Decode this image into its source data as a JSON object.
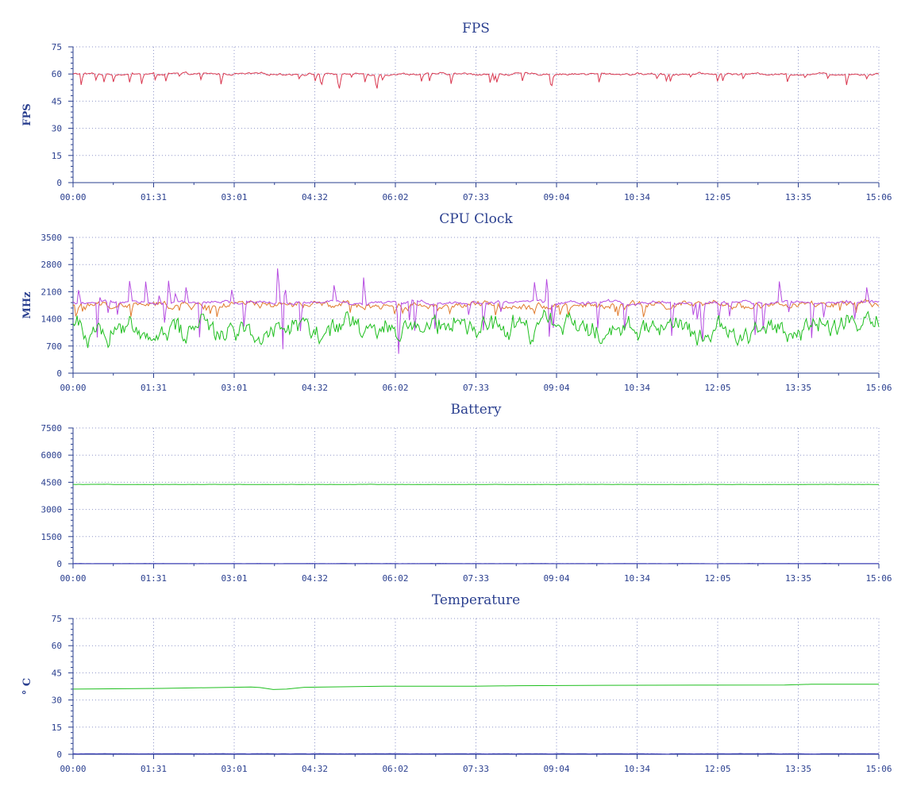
{
  "chart_data": [
    {
      "type": "line",
      "title": "FPS",
      "ylabel": "FPS",
      "ylim": [
        0,
        75
      ],
      "yticks": [
        "0",
        "15",
        "30",
        "45",
        "60",
        "75"
      ],
      "xticks": [
        "00:00",
        "01:31",
        "03:01",
        "04:32",
        "06:02",
        "07:33",
        "09:04",
        "10:34",
        "12:05",
        "13:35",
        "15:06"
      ],
      "xlim_seconds": [
        0,
        906
      ],
      "grid": true,
      "series": [
        {
          "color": "#d9374f",
          "base": 60,
          "noise": 0.8,
          "dips": 45,
          "dip_depth": 6,
          "lo": 52,
          "hi": 62
        }
      ]
    },
    {
      "type": "line",
      "title": "CPU Clock",
      "ylabel": "MHz",
      "ylim": [
        0,
        3500
      ],
      "yticks": [
        "0",
        "700",
        "1400",
        "2100",
        "2800",
        "3500"
      ],
      "xticks": [
        "00:00",
        "01:31",
        "03:01",
        "04:32",
        "06:02",
        "07:33",
        "09:04",
        "10:34",
        "12:05",
        "13:35",
        "15:06"
      ],
      "xlim_seconds": [
        0,
        906
      ],
      "grid": true,
      "series": [
        {
          "color": "#e07a2c",
          "base": 1750,
          "noise": 120,
          "dips": 25,
          "dip_depth": 300,
          "lo": 1450,
          "hi": 2250
        },
        {
          "color": "#b54be0",
          "base": 1820,
          "noise": 60,
          "dips": 35,
          "dip_depth": 900,
          "spikes": 18,
          "spike_height": 700,
          "lo": 500,
          "hi": 2700
        },
        {
          "color": "#1fbf1f",
          "base": 1150,
          "noise": 400,
          "lo": 650,
          "hi": 1700
        }
      ]
    },
    {
      "type": "line",
      "title": "Battery",
      "ylabel": "",
      "ylim": [
        0,
        7500
      ],
      "yticks": [
        "0",
        "1500",
        "3000",
        "4500",
        "6000",
        "7500"
      ],
      "xticks": [
        "00:00",
        "01:31",
        "03:01",
        "04:32",
        "06:02",
        "07:33",
        "09:04",
        "10:34",
        "12:05",
        "13:35",
        "15:06"
      ],
      "xlim_seconds": [
        0,
        906
      ],
      "grid": true,
      "series": [
        {
          "color": "#1fbf1f",
          "base": 4380,
          "noise": 8,
          "lo": 4360,
          "hi": 4400
        },
        {
          "color": "#3b3bb8",
          "base": 10,
          "noise": 8,
          "lo": 0,
          "hi": 25
        }
      ]
    },
    {
      "type": "line",
      "title": "Temperature",
      "ylabel": "° C",
      "ylim": [
        0,
        75
      ],
      "yticks": [
        "0",
        "15",
        "30",
        "45",
        "60",
        "75"
      ],
      "xticks": [
        "00:00",
        "01:31",
        "03:01",
        "04:32",
        "06:02",
        "07:33",
        "09:04",
        "10:34",
        "12:05",
        "13:35",
        "15:06"
      ],
      "xlim_seconds": [
        0,
        906
      ],
      "grid": true,
      "series": [
        {
          "color": "#1fbf1f",
          "points": [
            [
              0,
              36
            ],
            [
              100,
              36.4
            ],
            [
              200,
              37.2
            ],
            [
              210,
              36.9
            ],
            [
              225,
              35.8
            ],
            [
              240,
              36
            ],
            [
              260,
              37
            ],
            [
              350,
              37.6
            ],
            [
              450,
              37.6
            ],
            [
              500,
              37.9
            ],
            [
              600,
              38.1
            ],
            [
              700,
              38.2
            ],
            [
              800,
              38.3
            ],
            [
              830,
              38.7
            ],
            [
              906,
              38.7
            ]
          ]
        },
        {
          "color": "#3b3bb8",
          "base": 0.3,
          "noise": 0.1,
          "lo": 0,
          "hi": 0.6
        }
      ]
    }
  ]
}
